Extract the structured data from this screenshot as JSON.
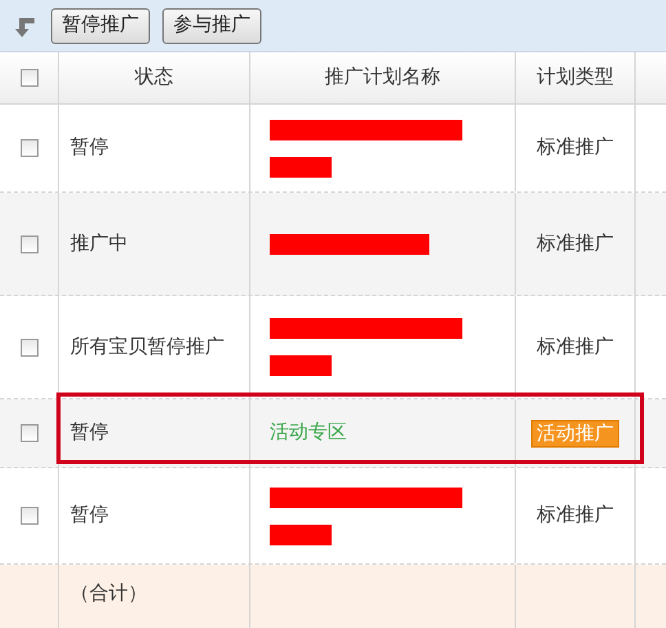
{
  "toolbar": {
    "buttons": [
      "暂停推广",
      "参与推广"
    ]
  },
  "table": {
    "header_checkbox": {
      "checked": false
    },
    "columns": [
      "状态",
      "推广计划名称",
      "计划类型"
    ],
    "rows": [
      {
        "checked": false,
        "status": "暂停",
        "name": {
          "kind": "redacted",
          "wrapped": true
        },
        "type": {
          "kind": "plain",
          "text": "标准推广"
        },
        "highlighted": false
      },
      {
        "checked": false,
        "status": "推广中",
        "name": {
          "kind": "redacted",
          "wrapped": false
        },
        "type": {
          "kind": "plain",
          "text": "标准推广"
        },
        "highlighted": false
      },
      {
        "checked": false,
        "status": "所有宝贝暂停推广",
        "name": {
          "kind": "redacted",
          "wrapped": true
        },
        "type": {
          "kind": "plain",
          "text": "标准推广"
        },
        "highlighted": false
      },
      {
        "checked": false,
        "status": "暂停",
        "name": {
          "kind": "link",
          "text": "活动专区"
        },
        "type": {
          "kind": "badge",
          "text": "活动推广"
        },
        "highlighted": true
      },
      {
        "checked": false,
        "status": "暂停",
        "name": {
          "kind": "redacted",
          "wrapped": true
        },
        "type": {
          "kind": "plain",
          "text": "标准推广"
        },
        "highlighted": false
      }
    ],
    "total_row": {
      "label": "（合计）"
    }
  }
}
